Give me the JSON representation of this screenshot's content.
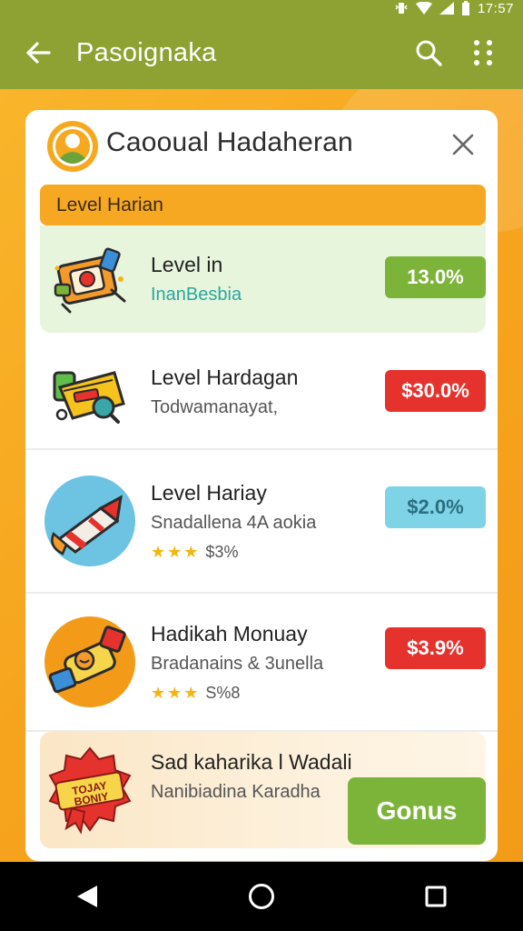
{
  "statusbar": {
    "time": "17:57"
  },
  "appbar": {
    "title": "Pasoignaka"
  },
  "card": {
    "title": "Caooual Hadaheran",
    "section_label": "Level Harian",
    "rows": [
      {
        "name": "Level in",
        "subtitle": "InanBesbia",
        "value": "13.0%",
        "value_color": "#7cb43a"
      },
      {
        "name": "Level Hardagan",
        "subtitle": "Todwamanayat,",
        "value": "$30.0%",
        "value_color": "#e5322d"
      },
      {
        "name": "Level Hariay",
        "subtitle": "Snadallena 4A aokia",
        "stars": "★★★",
        "rating": "$3%",
        "value": "$2.0%",
        "value_color": "#7fd3e6"
      },
      {
        "name": "Hadikah Monuay",
        "subtitle": "Bradanains & 3unella",
        "stars": "★★★",
        "rating": "S%8",
        "value": "$3.9%",
        "value_color": "#e5322d"
      },
      {
        "name": "Sad kaharika l Wadali",
        "subtitle": "Nanibiadina Karadha",
        "badge_text": "TOJAY BONIY",
        "button": "Gonus"
      }
    ]
  },
  "icons": {
    "back": "arrow-left-icon",
    "search": "search-icon",
    "more": "more-vert-icon",
    "close": "close-icon",
    "nav_back": "nav-back-icon",
    "nav_home": "nav-home-icon",
    "nav_recents": "nav-recents-icon"
  },
  "colors": {
    "appbar": "#8da232",
    "background": "#f7a823",
    "accent_green": "#7cb43a",
    "accent_red": "#e5322d",
    "accent_cyan": "#7fd3e6"
  }
}
